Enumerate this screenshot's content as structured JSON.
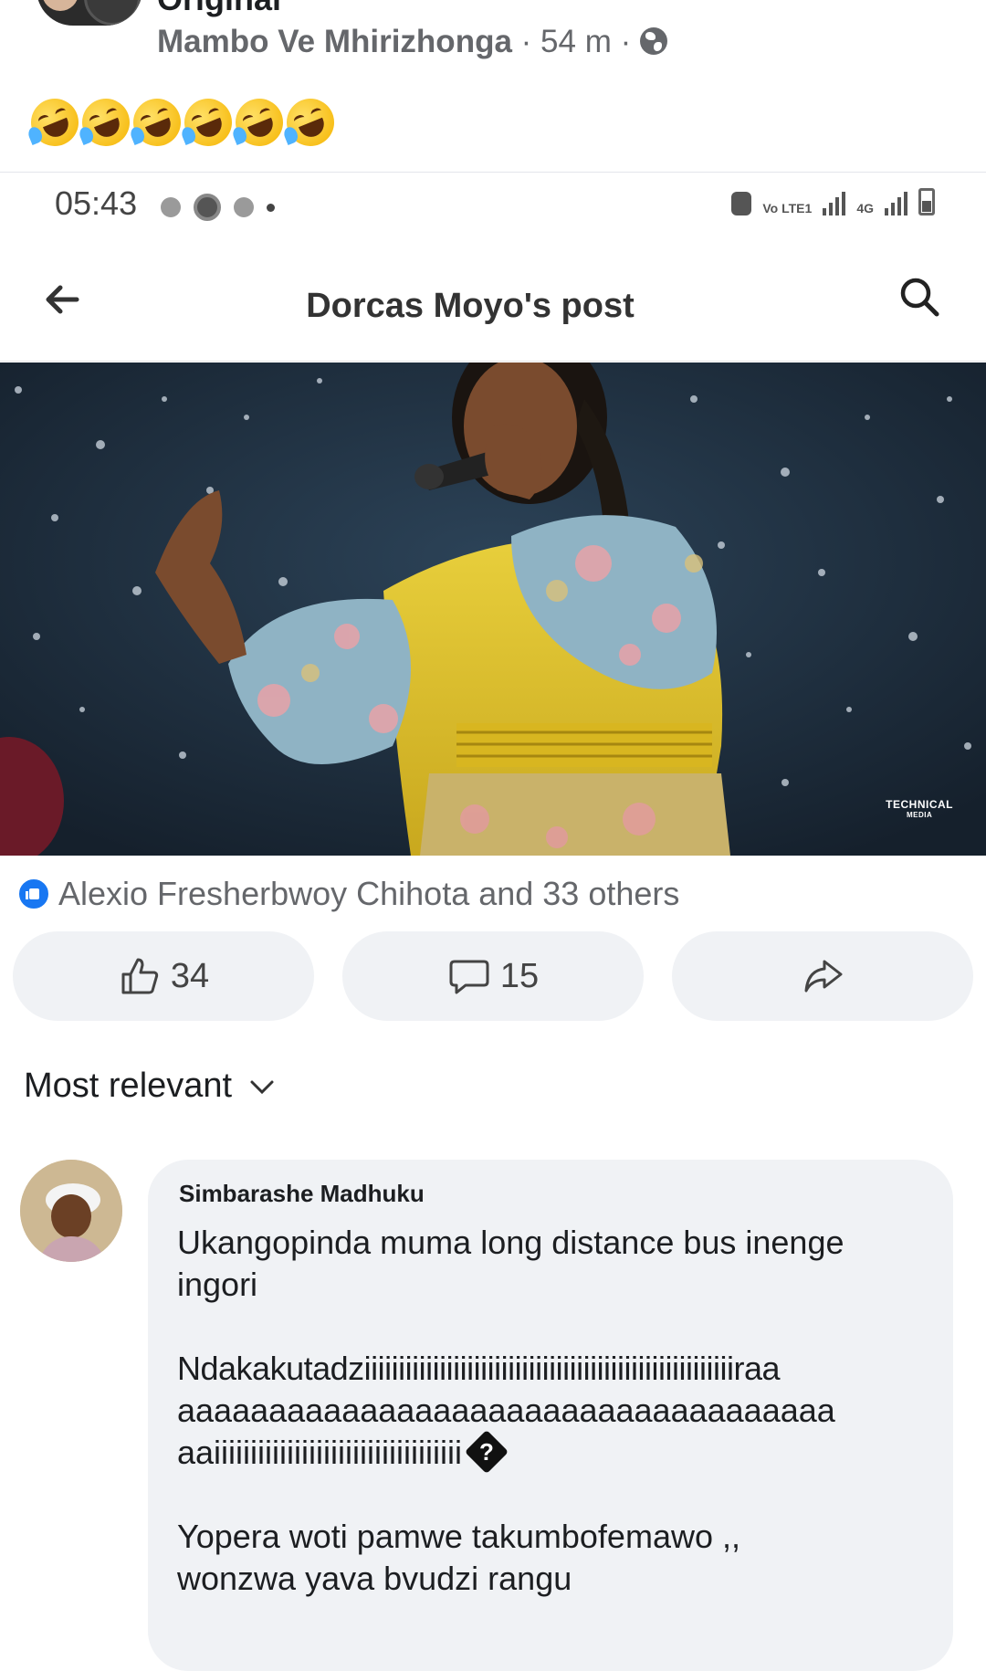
{
  "outer_post": {
    "title_partial": "Original",
    "page_name": "Mambo Ve Mhirizhonga",
    "separator": "·",
    "time": "54 m",
    "privacy_icon": "globe-icon",
    "emoji_icon": "rolling-on-floor-laughing-emoji",
    "emoji_count": 6
  },
  "status_bar": {
    "time": "05:43",
    "network_labels": [
      "Vo LTE1",
      "4G"
    ]
  },
  "appbar": {
    "back_icon": "back-arrow-icon",
    "title": "Dorcas Moyo's post",
    "search_icon": "search-icon"
  },
  "photo": {
    "watermark_line1": "TECHNICAL",
    "watermark_line2": "MEDIA"
  },
  "reactions": {
    "summary": "Alexio Fresherbwoy Chihota and 33 others",
    "like_count": "34",
    "comment_count": "15"
  },
  "comments": {
    "sort_label": "Most relevant",
    "items": [
      {
        "author": "Simbarashe Madhuku",
        "lines": [
          "Ukangopinda muma long distance bus inenge",
          "ingori",
          "Ndakakutadziiiiiiiiiiiiiiiiiiiiiiiiiiiiiiiiiiiiiiiiiiiiiiiiiiiiiiraa",
          "aaaaaaaaaaaaaaaaaaaaaaaaaaaaaaaaaaaa",
          "aaiiiiiiiiiiiiiiiiiiiiiiiiiiiiiiiiii",
          "Yopera woti pamwe takumbofemawo ,,",
          "wonzwa yava bvudzi rangu"
        ],
        "glyph": "?"
      }
    ]
  },
  "colors": {
    "brand_blue": "#1877f2",
    "meta_gray": "#65676b",
    "bubble_bg": "#f0f2f5"
  }
}
